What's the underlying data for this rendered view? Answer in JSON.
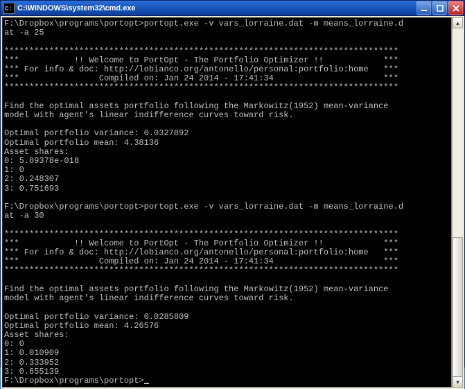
{
  "window": {
    "title": "C:\\WINDOWS\\system32\\cmd.exe",
    "icon": "cmd-icon"
  },
  "runs": [
    {
      "prompt_path": "F:\\Dropbox\\programs\\portopt>",
      "command": "portopt.exe -v vars_lorraine.dat -m means_lorraine.dat -a 25",
      "command_wrapped_lines": [
        "F:\\Dropbox\\programs\\portopt>portopt.exe -v vars_lorraine.dat -m means_lorraine.d",
        "at -a 25"
      ],
      "banner": {
        "line_stars": "*******************************************************************************",
        "welcome": "***           !! Welcome to PortOpt - The Portfolio Optimizer !!            ***",
        "info": "*** For info & doc: http://lobianco.org/antonello/personal:portfolio:home   ***",
        "compiled": "***                Compiled on: Jan 24 2014 - 17:41:34                      ***"
      },
      "description_lines": [
        "Find the optimal assets portfolio following the Markowitz(1952) mean-variance",
        "model with agent's linear indifference curves toward risk."
      ],
      "results": {
        "variance_label": "Optimal portfolio variance:",
        "variance": "0.0327892",
        "mean_label": "Optimal portfolio mean:",
        "mean": "4.38136",
        "shares_label": "Asset shares:",
        "shares": [
          {
            "idx": "0",
            "val": "5.89378e-018"
          },
          {
            "idx": "1",
            "val": "0"
          },
          {
            "idx": "2",
            "val": "0.248307"
          },
          {
            "idx": "3",
            "val": "0.751693"
          }
        ]
      }
    },
    {
      "prompt_path": "F:\\Dropbox\\programs\\portopt>",
      "command": "portopt.exe -v vars_lorraine.dat -m means_lorraine.dat -a 30",
      "command_wrapped_lines": [
        "F:\\Dropbox\\programs\\portopt>portopt.exe -v vars_lorraine.dat -m means_lorraine.d",
        "at -a 30"
      ],
      "banner": {
        "line_stars": "*******************************************************************************",
        "welcome": "***           !! Welcome to PortOpt - The Portfolio Optimizer !!            ***",
        "info": "*** For info & doc: http://lobianco.org/antonello/personal:portfolio:home   ***",
        "compiled": "***                Compiled on: Jan 24 2014 - 17:41:34                      ***"
      },
      "description_lines": [
        "Find the optimal assets portfolio following the Markowitz(1952) mean-variance",
        "model with agent's linear indifference curves toward risk."
      ],
      "results": {
        "variance_label": "Optimal portfolio variance:",
        "variance": "0.0285809",
        "mean_label": "Optimal portfolio mean:",
        "mean": "4.26576",
        "shares_label": "Asset shares:",
        "shares": [
          {
            "idx": "0",
            "val": "0"
          },
          {
            "idx": "1",
            "val": "0.010909"
          },
          {
            "idx": "2",
            "val": "0.333952"
          },
          {
            "idx": "3",
            "val": "0.655139"
          }
        ]
      }
    }
  ],
  "final_prompt": "F:\\Dropbox\\programs\\portopt>"
}
